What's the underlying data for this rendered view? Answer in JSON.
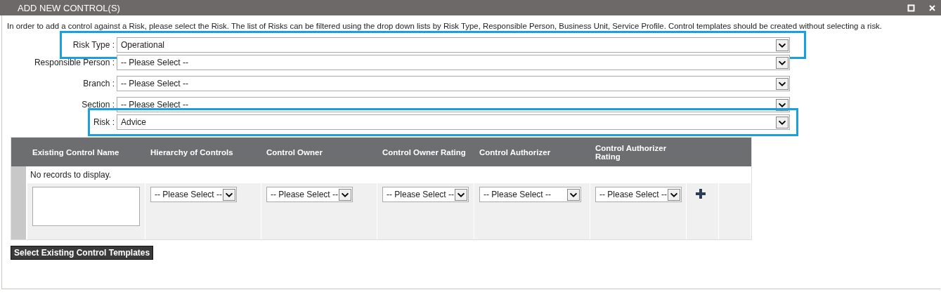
{
  "window": {
    "title": "ADD NEW CONTROL(S)"
  },
  "intro": "In order to add a control against a Risk, please select the Risk. The list of Risks can be filtered using the drop down lists by Risk Type, Responsible Person, Business Unit, Service Profile. Control templates should be created without selecting a risk.",
  "filters": [
    {
      "label": "Risk Type :",
      "value": "Operational",
      "highlighted": true
    },
    {
      "label": "Responsible Person :",
      "value": "-- Please Select --",
      "highlighted": false
    },
    {
      "label": "Branch :",
      "value": "-- Please Select --",
      "highlighted": false
    },
    {
      "label": "Section :",
      "value": "-- Please Select --",
      "highlighted": false
    },
    {
      "label": "Risk :",
      "value": "Advice",
      "highlighted": true
    }
  ],
  "table": {
    "columns": [
      "Existing Control Name",
      "Hierarchy of Controls",
      "Control Owner",
      "Control Owner Rating",
      "Control Authorizer",
      "Control Authorizer Rating"
    ],
    "empty_message": "No records to display.",
    "new_row": [
      {
        "kind": "textarea"
      },
      {
        "kind": "select",
        "value": "-- Please Select --"
      },
      {
        "kind": "select",
        "value": "-- Please Select --"
      },
      {
        "kind": "select",
        "value": "-- Please Select --"
      },
      {
        "kind": "select",
        "value": "-- Please Select --"
      },
      {
        "kind": "select",
        "value": "-- Please Select --"
      },
      {
        "kind": "add"
      }
    ]
  },
  "button": "Select Existing Control Templates"
}
